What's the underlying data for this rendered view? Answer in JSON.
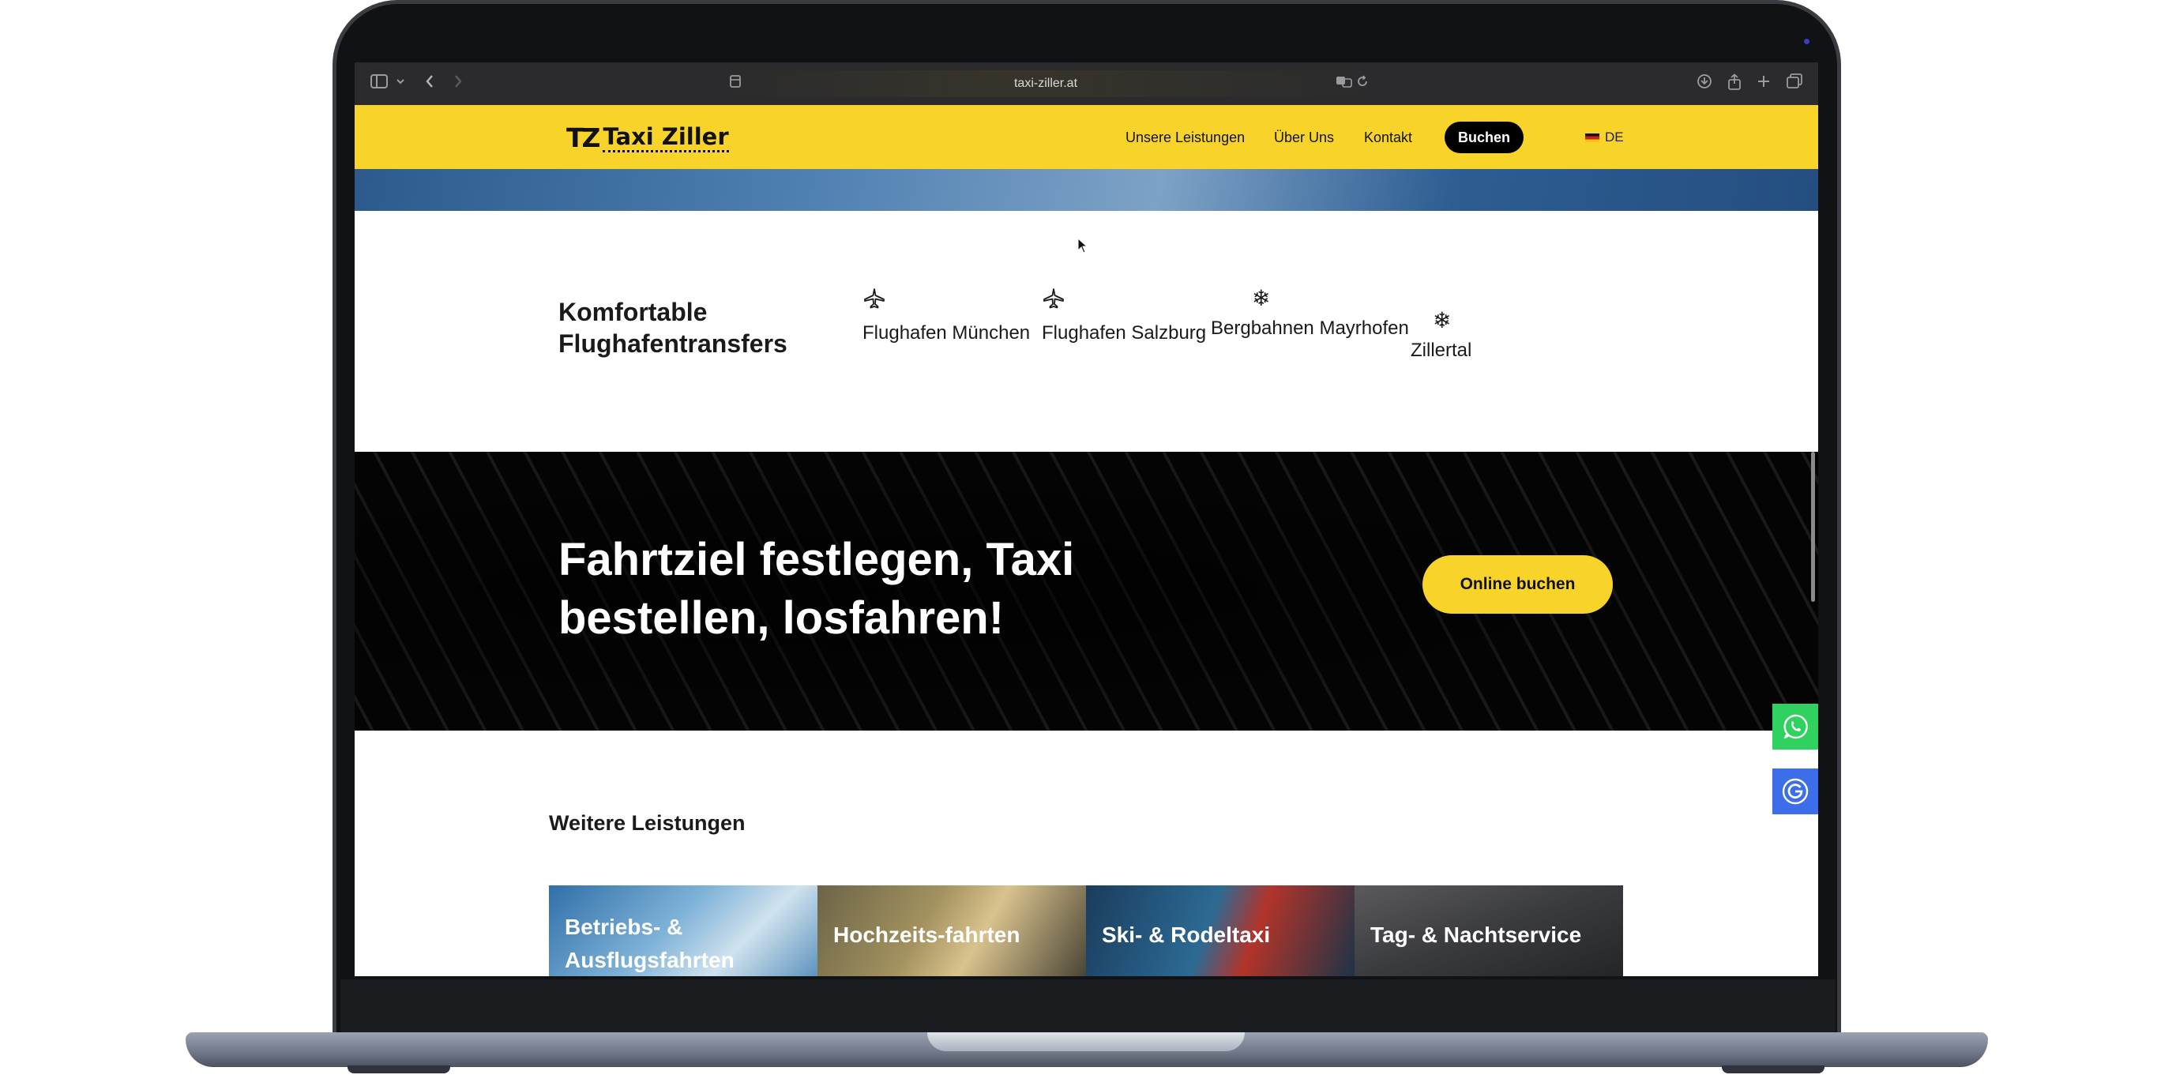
{
  "browser": {
    "url": "taxi-ziller.at",
    "icons": [
      "sidebar-icon",
      "chevron-down-icon",
      "back-icon",
      "forward-icon",
      "page-icon",
      "translate-icon",
      "reload-icon",
      "download-icon",
      "share-icon",
      "new-tab-icon",
      "tabs-overview-icon"
    ]
  },
  "header": {
    "logo_mark": "TZ",
    "logo_text": "Taxi Ziller",
    "nav": [
      "Unsere Leistungen",
      "Über Uns",
      "Kontakt"
    ],
    "book_label": "Buchen",
    "language": "DE",
    "brand_color": "#f8d42a"
  },
  "transfers": {
    "title": "Komfortable Flughafentransfers",
    "destinations": [
      {
        "icon": "airplane-icon",
        "label": "Flughafen München"
      },
      {
        "icon": "airplane-icon",
        "label": "Flughafen Salzburg"
      },
      {
        "icon": "snowflake-icon",
        "label": "Bergbahnen Mayrhofen"
      },
      {
        "icon": "snowflake-icon",
        "label": "Zillertal"
      }
    ]
  },
  "banner": {
    "title": "Fahrtziel festlegen, Taxi bestellen, losfahren!",
    "button_label": "Online buchen"
  },
  "services": {
    "title": "Weitere Leistungen",
    "tiles": [
      "Betriebs- & Ausflugsfahrten",
      "Hochzeits-fahrten",
      "Ski- & Rodeltaxi",
      "Tag- & Nachtservice"
    ]
  },
  "floating": {
    "whatsapp_icon": "whatsapp-icon",
    "google_icon": "google-icon",
    "whatsapp_color": "#2fd15f",
    "google_color": "#3b6ee8"
  }
}
